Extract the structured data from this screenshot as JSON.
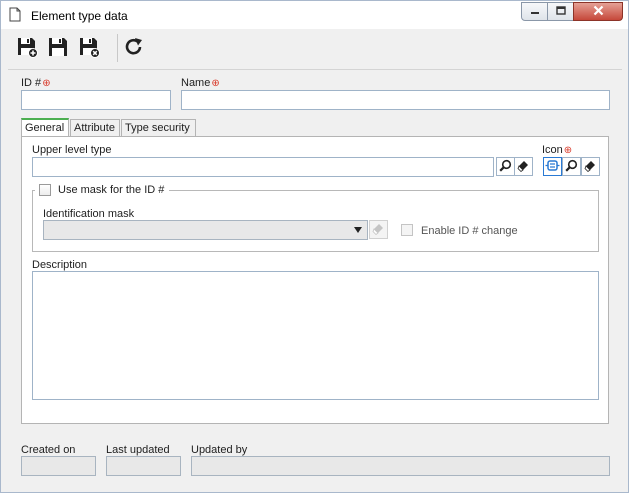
{
  "window": {
    "title": "Element type data",
    "minimize_icon": "minimize-icon",
    "maximize_icon": "maximize-icon",
    "close_icon": "close-icon"
  },
  "toolbar": {
    "buttons": [
      {
        "name": "save-new-button",
        "icon": "save-new-icon"
      },
      {
        "name": "save-button",
        "icon": "save-icon"
      },
      {
        "name": "save-close-button",
        "icon": "save-close-icon"
      },
      {
        "name": "refresh-button",
        "icon": "refresh-icon"
      }
    ]
  },
  "form": {
    "id_label": "ID #",
    "id_value": "",
    "name_label": "Name",
    "name_value": "",
    "required_marker": "⊕"
  },
  "tabs": [
    {
      "label": "General",
      "active": true
    },
    {
      "label": "Attribute",
      "active": false
    },
    {
      "label": "Type security",
      "active": false
    }
  ],
  "general": {
    "upper_level_label": "Upper level type",
    "upper_level_value": "",
    "icon_label": "Icon",
    "use_mask_label": "Use mask for the ID #",
    "use_mask_checked": false,
    "identification_mask_label": "Identification mask",
    "identification_mask_value": "",
    "enable_id_change_label": "Enable ID # change",
    "enable_id_change_checked": false,
    "description_label": "Description",
    "description_value": ""
  },
  "footer": {
    "created_on_label": "Created on",
    "created_on_value": "",
    "last_updated_label": "Last updated",
    "last_updated_value": "",
    "updated_by_label": "Updated by",
    "updated_by_value": ""
  },
  "colors": {
    "required": "#d93a2a",
    "active_tab_accent": "#4caf50",
    "icon_blue": "#2a7ad4",
    "input_border": "#9fb3c8",
    "close_button": "#c6483a"
  }
}
